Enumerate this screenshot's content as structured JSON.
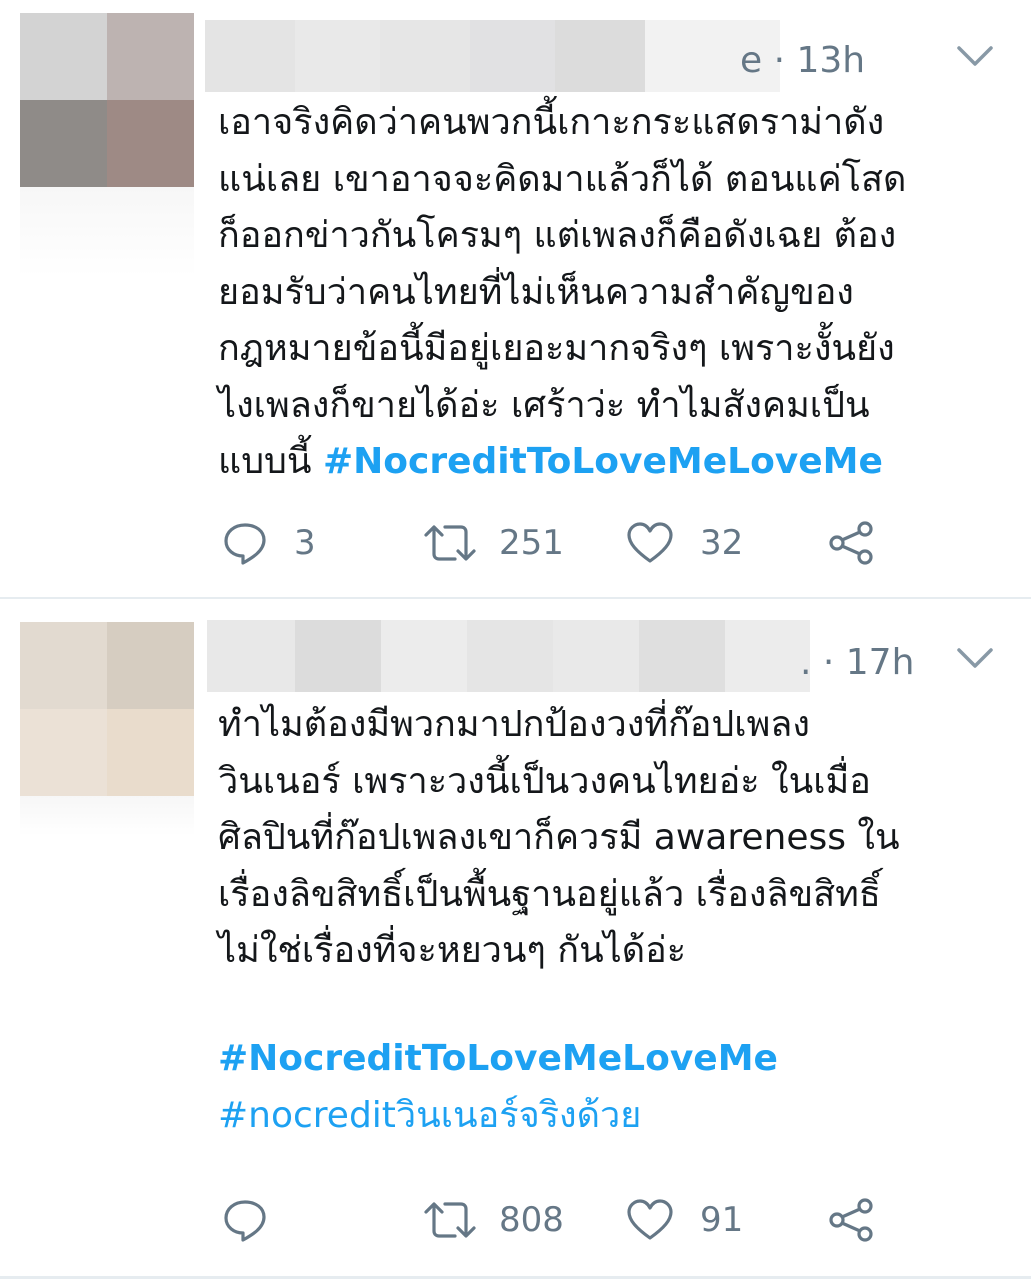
{
  "tweets": [
    {
      "time": "e · 13h",
      "lines": [
        "เอาจริงคิดว่าคนพวกนี้เกาะกระแสดราม่าดัง",
        "แน่เลย เขาอาจจะคิดมาแล้วก็ได้ ตอนแค่โสด",
        "ก็ออกข่าวกันโครมๆ แต่เพลงก็คือดังเฉย ต้อง",
        "ยอมรับว่าคนไทยที่ไม่เห็นความสำคัญของ",
        "กฎหมายข้อนี้มีอยู่เยอะมากจริงๆ เพราะงั้นยัง",
        "ไงเพลงก็ขายได้อ่ะ เศร้าว่ะ ทำไมสังคมเป็น"
      ],
      "last_line_prefix": "แบบนี้ ",
      "last_line_hashtag": "#NocreditToLoveMeLoveMe",
      "reply_count": "3",
      "retweet_count": "251",
      "like_count": "32"
    },
    {
      "time": ". · 17h",
      "lines": [
        "ทำไมต้องมีพวกมาปกป้องวงที่ก๊อปเพลง",
        "วินเนอร์ เพราะวงนี้เป็นวงคนไทยอ่ะ ในเมื่อ",
        "ศิลปินที่ก๊อปเพลงเขาก็ควรมี awareness ใน",
        "เรื่องลิขสิทธิ์เป็นพื้นฐานอยู่แล้ว เรื่องลิขสิทธิ์",
        "ไม่ใช่เรื่องที่จะหยวนๆ กันได้อ่ะ"
      ],
      "hashtag_1": "#NocreditToLoveMeLoveMe",
      "hashtag_2": "#nocreditวินเนอร์จริงด้วย",
      "reply_count": "",
      "retweet_count": "808",
      "like_count": "91"
    }
  ],
  "icons": {
    "reply": "reply-icon",
    "retweet": "retweet-icon",
    "like": "heart-icon",
    "share": "share-icon",
    "menu": "chevron-down-icon"
  },
  "colors": {
    "text": "#14171a",
    "secondary": "#657786",
    "hashtag": "#1da1f2",
    "divider": "#e6ecf0"
  }
}
